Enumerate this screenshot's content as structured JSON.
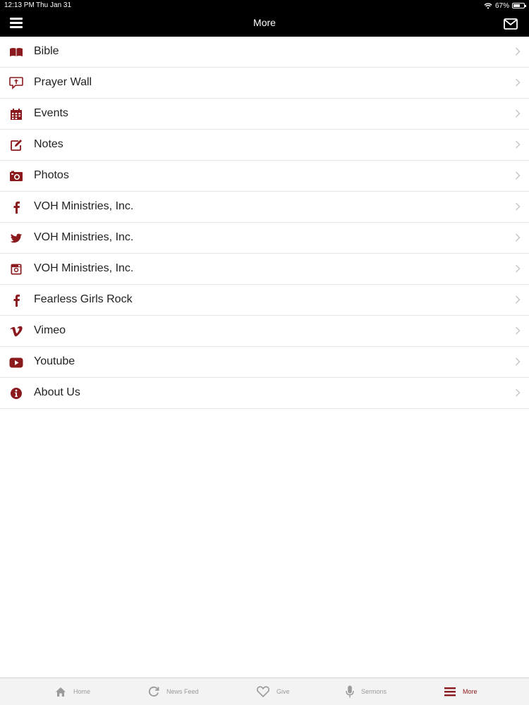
{
  "status_bar": {
    "time": "12:13 PM",
    "date": "Thu Jan 31",
    "battery": "67%",
    "battery_level": 0.67
  },
  "nav_bar": {
    "title": "More",
    "menu_icon": "hamburger-icon",
    "mail_icon": "envelope-icon"
  },
  "theme": {
    "accent": "#8b1a1e",
    "bar_bg": "#000000",
    "tab_inactive": "#9a9a9a"
  },
  "menu_items": [
    {
      "label": "Bible",
      "icon": "bible-icon"
    },
    {
      "label": "Prayer Wall",
      "icon": "prayer-bubble-icon"
    },
    {
      "label": "Events",
      "icon": "calendar-icon"
    },
    {
      "label": "Notes",
      "icon": "edit-icon"
    },
    {
      "label": "Photos",
      "icon": "camera-icon"
    },
    {
      "label": "VOH Ministries, Inc.",
      "icon": "facebook-icon"
    },
    {
      "label": "VOH Ministries, Inc.",
      "icon": "twitter-icon"
    },
    {
      "label": "VOH Ministries, Inc.",
      "icon": "instagram-icon"
    },
    {
      "label": "Fearless Girls Rock",
      "icon": "facebook-icon"
    },
    {
      "label": "Vimeo",
      "icon": "vimeo-icon"
    },
    {
      "label": "Youtube",
      "icon": "youtube-icon"
    },
    {
      "label": "About Us",
      "icon": "info-icon"
    }
  ],
  "tab_bar": [
    {
      "label": "Home",
      "icon": "home-icon",
      "active": false
    },
    {
      "label": "News Feed",
      "icon": "refresh-icon",
      "active": false
    },
    {
      "label": "Give",
      "icon": "heart-icon",
      "active": false
    },
    {
      "label": "Sermons",
      "icon": "microphone-icon",
      "active": false
    },
    {
      "label": "More",
      "icon": "hamburger-icon",
      "active": true
    }
  ]
}
